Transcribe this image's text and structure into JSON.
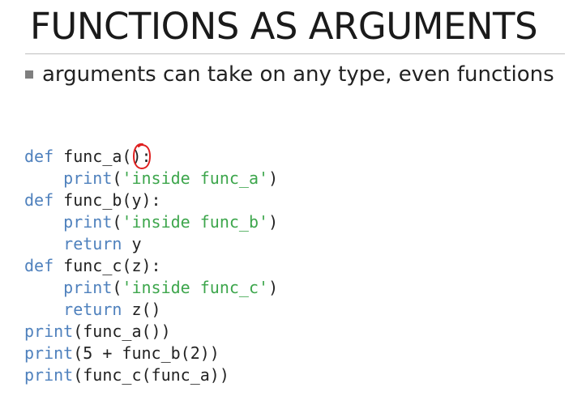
{
  "slide": {
    "title": "FUNCTIONS AS ARGUMENTS",
    "bullet": "arguments can take on any type, even functions"
  },
  "code_lines": [
    [
      {
        "t": "def",
        "c": "kw"
      },
      {
        "t": " func_a():",
        "c": "plain"
      }
    ],
    [
      {
        "t": "    ",
        "c": "plain"
      },
      {
        "t": "print",
        "c": "kw"
      },
      {
        "t": "(",
        "c": "plain"
      },
      {
        "t": "'inside func_a'",
        "c": "str"
      },
      {
        "t": ")",
        "c": "plain"
      }
    ],
    [
      {
        "t": "def",
        "c": "kw"
      },
      {
        "t": " func_b(y):",
        "c": "plain"
      }
    ],
    [
      {
        "t": "    ",
        "c": "plain"
      },
      {
        "t": "print",
        "c": "kw"
      },
      {
        "t": "(",
        "c": "plain"
      },
      {
        "t": "'inside func_b'",
        "c": "str"
      },
      {
        "t": ")",
        "c": "plain"
      }
    ],
    [
      {
        "t": "    ",
        "c": "plain"
      },
      {
        "t": "return",
        "c": "kw"
      },
      {
        "t": " y",
        "c": "plain"
      }
    ],
    [
      {
        "t": "def",
        "c": "kw"
      },
      {
        "t": " func_c(z):",
        "c": "plain"
      }
    ],
    [
      {
        "t": "    ",
        "c": "plain"
      },
      {
        "t": "print",
        "c": "kw"
      },
      {
        "t": "(",
        "c": "plain"
      },
      {
        "t": "'inside func_c'",
        "c": "str"
      },
      {
        "t": ")",
        "c": "plain"
      }
    ],
    [
      {
        "t": "    ",
        "c": "plain"
      },
      {
        "t": "return",
        "c": "kw"
      },
      {
        "t": " z()",
        "c": "plain"
      }
    ],
    [
      {
        "t": "print",
        "c": "kw"
      },
      {
        "t": "(func_a())",
        "c": "plain"
      }
    ],
    [
      {
        "t": "print",
        "c": "kw"
      },
      {
        "t": "(5 + func_b(2))",
        "c": "plain"
      }
    ],
    [
      {
        "t": "print",
        "c": "kw"
      },
      {
        "t": "(func_c(func_a))",
        "c": "plain"
      }
    ]
  ],
  "colors": {
    "keyword": "#4f81bd",
    "string": "#3da64c",
    "text": "#222222",
    "annotation": "#e02020"
  }
}
